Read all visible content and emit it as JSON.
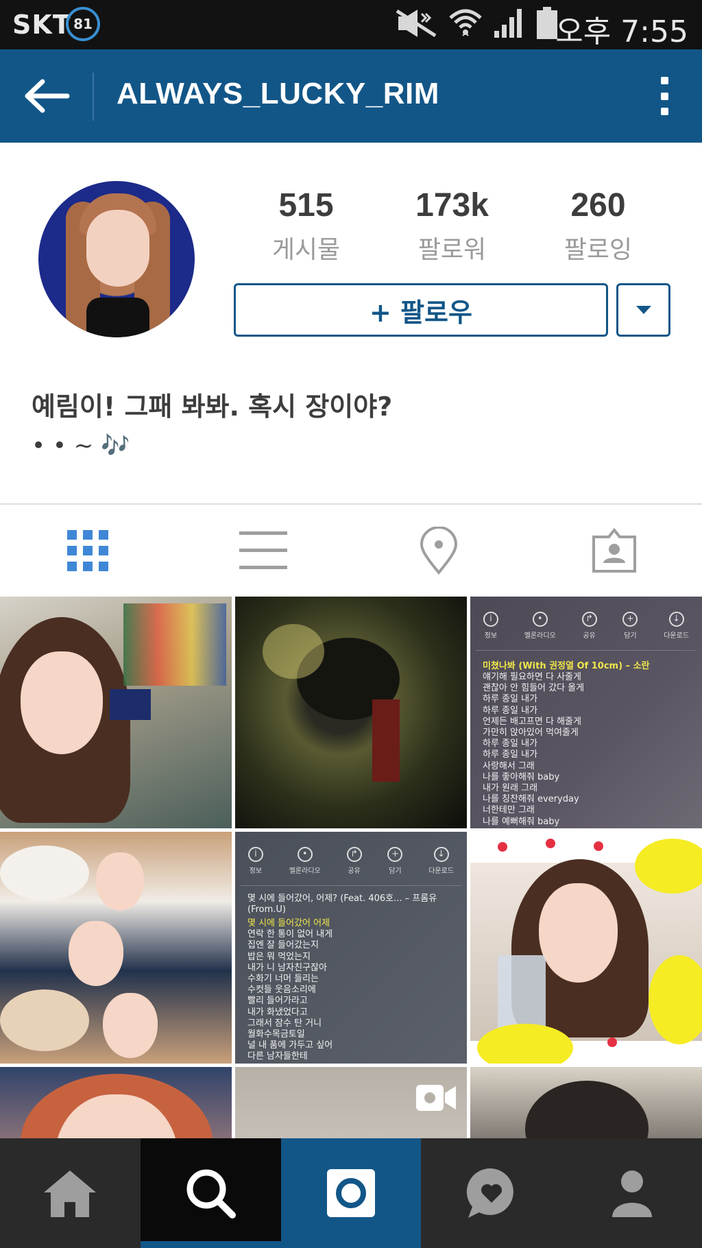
{
  "status_bar": {
    "carrier": "SKT",
    "battery_level": "81",
    "time": "오후 7:55"
  },
  "header": {
    "username": "ALWAYS_LUCKY_RIM"
  },
  "profile": {
    "stats": [
      {
        "value": "515",
        "label": "게시물"
      },
      {
        "value": "173k",
        "label": "팔로워"
      },
      {
        "value": "260",
        "label": "팔로잉"
      }
    ],
    "follow_label": "+ 팔로우",
    "bio_line1": "예림이! 그패 봐봐. 혹시 장이야?",
    "bio_line2": "• • ~ 🎶"
  },
  "view_tabs": [
    "grid-view",
    "list-view",
    "location-view",
    "tagged-view"
  ],
  "grid": {
    "lyric1": {
      "icons": [
        "정보",
        "멜론라디오",
        "공유",
        "담기",
        "다운로드"
      ],
      "title": "미쳤나봐 (With 권정열 Of 10cm) – 소란",
      "lines": "얘기해 필요하면 다 사줄게\n괜찮아 안 힘들어 갔다 올게\n하루 종일 내가\n하루 종일 내가\n언제든 배고프면 다 해줄게\n가만히 앉아있어 먹여줄게\n하루 종일 내가\n하루 종일 내가\n사랑해서 그래\n나를 좋아해줘 baby\n내가 원래 그래\n나를 칭찬해줘 everyday\n너한테만 그래\n나를 예뻐해줘 baby"
    },
    "lyric2": {
      "icons": [
        "정보",
        "멜론라디오",
        "공유",
        "담기",
        "다운로드"
      ],
      "title": "몇 시에 들어갔어, 어제? (Feat. 406호... – 프롬유 (From.U)",
      "highlight": "몇 시에 들어갔어 어제",
      "lines": "연락 한 통이 없어 내게\n집엔 잘 들어갔는지\n밥은 뭐 먹었는지\n내가 니 남자친구잖아\n수화기 너머 들리는\n수컷들 웃음소리에\n빨리 들어가라고\n내가 화냈었다고\n그래서 잠수 탄 거니\n월화수목금토일\n널 내 품에 가두고 싶어\n다른 남자들한테"
    }
  },
  "bottom_nav": [
    "home",
    "search",
    "camera",
    "activity",
    "profile"
  ],
  "colors": {
    "brand_blue": "#125688",
    "status_bar_bg": "#121212",
    "nav_bg": "#2a2a2a",
    "active_tab": "#3f87d6",
    "inactive_icon": "#9e9e9e"
  }
}
